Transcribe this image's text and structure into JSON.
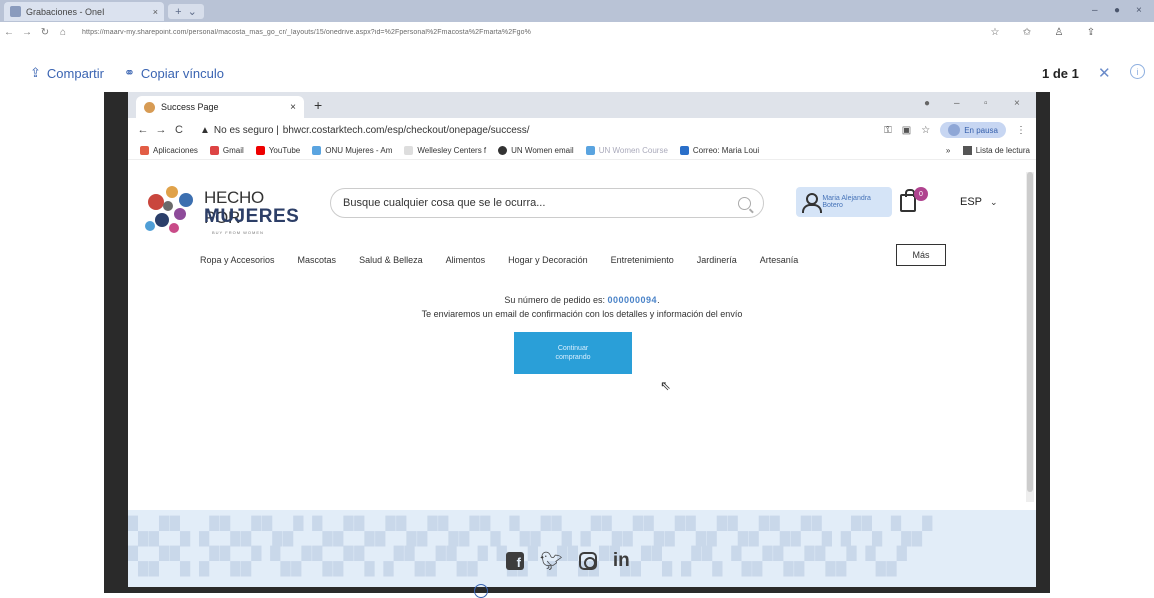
{
  "outer_browser": {
    "tab_title": "Grabaciones - OneI",
    "url": "https://maarv-my.sharepoint.com/personal/macosta_mas_go_cr/_layouts/15/onedrive.aspx?id=%2Fpersonal%2Fmacosta%2Fmarta%2Fgo%"
  },
  "viewer": {
    "share_label": "Compartir",
    "copy_link_label": "Copiar vínculo",
    "page_counter": "1 de 1",
    "close_icon": "close-icon",
    "info_icon": "info-icon"
  },
  "inner_browser": {
    "tab_title": "Success Page",
    "security_warning": "No es seguro",
    "url": "bhwcr.costarktech.com/esp/checkout/onepage/success/",
    "profile_pill": "En pausa",
    "bookmarks": [
      "Aplicaciones",
      "Gmail",
      "YouTube",
      "ONU Mujeres - Am",
      "Wellesley Centers f",
      "UN Women email",
      "UN Women Course",
      "Correo: Maria Loui"
    ],
    "reading_list": "Lista de lectura"
  },
  "site": {
    "logo_line1": "HECHO POR",
    "logo_line2": "MUJERES",
    "logo_tagline": "BUY FROM WOMEN",
    "search_placeholder": "Busque cualquier cosa que se le ocurra...",
    "user_name": "Maria Alejandra Botero",
    "cart_count": "0",
    "language": "ESP",
    "categories": [
      "Ropa y Accesorios",
      "Mascotas",
      "Salud & Belleza",
      "Alimentos",
      "Hogar y Decoración",
      "Entretenimiento",
      "Jardinería",
      "Artesanía"
    ],
    "more_label": "Más",
    "order_prefix": "Su número de pedido es: ",
    "order_number": "000000094",
    "order_suffix": ".",
    "confirmation_text": "Te enviaremos un email de confirmación con los detalles y información del envío",
    "continue_line1": "Continuar",
    "continue_line2": "comprando",
    "social": [
      "facebook",
      "twitter",
      "instagram",
      "linkedin"
    ]
  },
  "colors": {
    "accent": "#3a64b2",
    "button": "#2a9fd8",
    "brand_navy": "#2c3e67",
    "cart_badge": "#b0438f"
  }
}
